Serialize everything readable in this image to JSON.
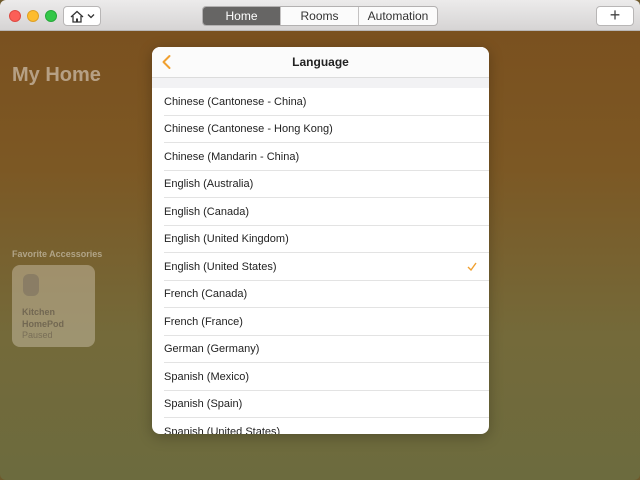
{
  "toolbar": {
    "tabs": [
      {
        "label": "Home",
        "active": true
      },
      {
        "label": "Rooms",
        "active": false
      },
      {
        "label": "Automation",
        "active": false
      }
    ],
    "add_label": "+"
  },
  "background": {
    "title": "My Home",
    "favorites_label": "Favorite Accessories",
    "tile": {
      "name_line1": "Kitchen",
      "name_line2": "HomePod",
      "status": "Paused"
    }
  },
  "sheet": {
    "title": "Language",
    "languages": [
      {
        "label": "Chinese (Cantonese - China)",
        "selected": false
      },
      {
        "label": "Chinese (Cantonese - Hong Kong)",
        "selected": false
      },
      {
        "label": "Chinese (Mandarin - China)",
        "selected": false
      },
      {
        "label": "English (Australia)",
        "selected": false
      },
      {
        "label": "English (Canada)",
        "selected": false
      },
      {
        "label": "English (United Kingdom)",
        "selected": false
      },
      {
        "label": "English (United States)",
        "selected": true
      },
      {
        "label": "French (Canada)",
        "selected": false
      },
      {
        "label": "French (France)",
        "selected": false
      },
      {
        "label": "German (Germany)",
        "selected": false
      },
      {
        "label": "Spanish (Mexico)",
        "selected": false
      },
      {
        "label": "Spanish (Spain)",
        "selected": false
      },
      {
        "label": "Spanish (United States)",
        "selected": false
      }
    ]
  },
  "colors": {
    "accent": "#f0a030",
    "active_tab": "#666564"
  },
  "icons": {
    "back": "chevron-left-icon",
    "check": "checkmark-icon",
    "home": "house-icon"
  }
}
